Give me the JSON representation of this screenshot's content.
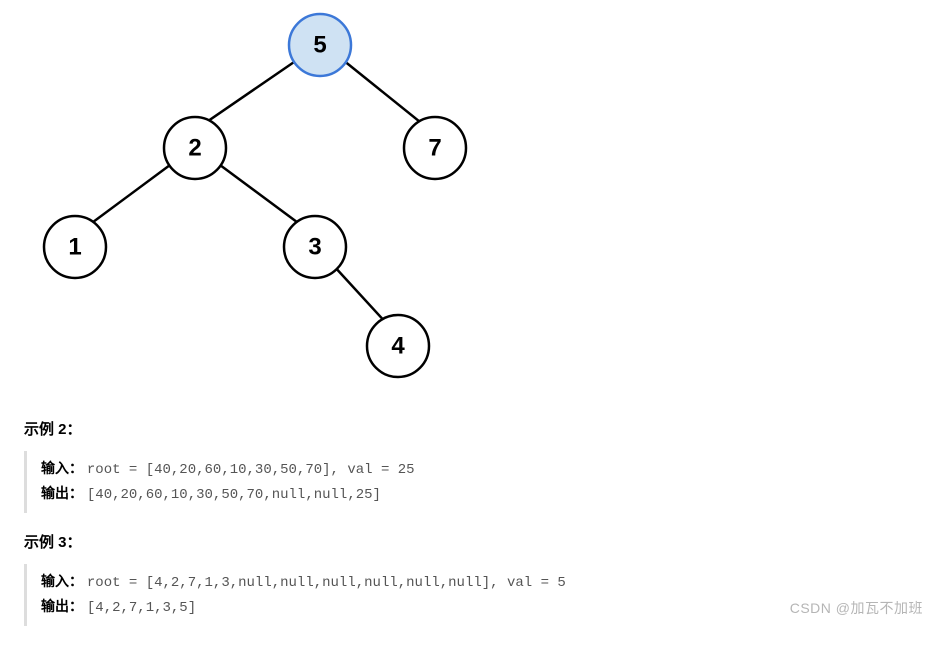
{
  "tree": {
    "nodes": {
      "n5": "5",
      "n2": "2",
      "n7": "7",
      "n1": "1",
      "n3": "3",
      "n4": "4"
    }
  },
  "examples": [
    {
      "heading": "示例 2：",
      "input_label": "输入：",
      "input_value": "root = [40,20,60,10,30,50,70], val = 25",
      "output_label": "输出：",
      "output_value": "[40,20,60,10,30,50,70,null,null,25]"
    },
    {
      "heading": "示例 3：",
      "input_label": "输入：",
      "input_value": "root = [4,2,7,1,3,null,null,null,null,null,null], val = 5",
      "output_label": "输出：",
      "output_value": "[4,2,7,1,3,5]"
    }
  ],
  "watermark": "CSDN @加瓦不加班"
}
